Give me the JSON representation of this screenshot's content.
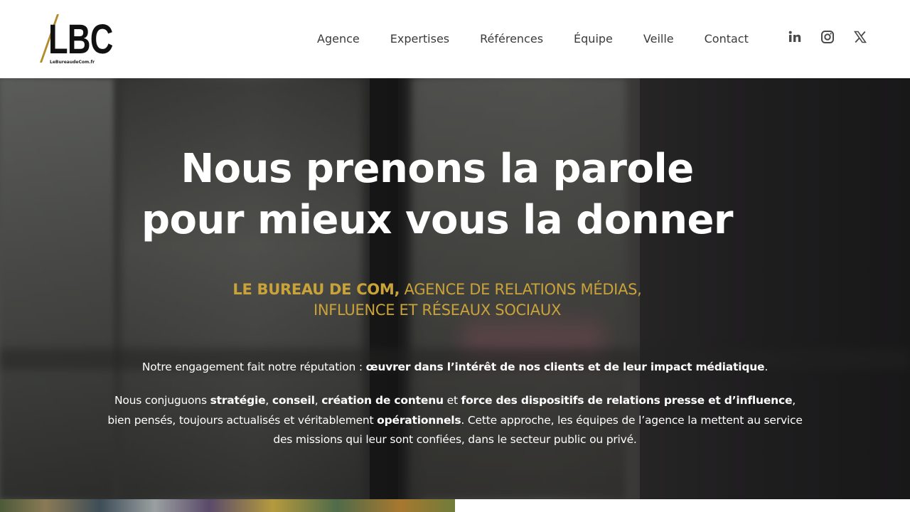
{
  "brand": {
    "logo_text": "LBC",
    "logo_subtext": "LeBureaudeCom.fr",
    "accent_color": "#c9a23a",
    "stroke_color": "#b38a2c"
  },
  "nav": {
    "items": [
      {
        "label": "Agence"
      },
      {
        "label": "Expertises"
      },
      {
        "label": "Références"
      },
      {
        "label": "Équipe"
      },
      {
        "label": "Veille"
      },
      {
        "label": "Contact"
      }
    ]
  },
  "social": {
    "linkedin_icon": "linkedin-icon",
    "instagram_icon": "instagram-icon",
    "x_icon": "x-icon"
  },
  "hero": {
    "title_line1": "Nous prenons la parole",
    "title_line2": "pour mieux vous la donner",
    "subtitle_bold": "LE BUREAU DE COM,",
    "subtitle_rest1": " AGENCE DE RELATIONS MÉDIAS,",
    "subtitle_line2": "INFLUENCE ET RÉSEAUX SOCIAUX",
    "p1_a": "Notre engagement fait notre réputation : ",
    "p1_b": "œuvrer dans l’intérêt de nos clients et de leur impact médiatique",
    "p1_c": ".",
    "p2_a": "Nous conjuguons ",
    "p2_b": "stratégie",
    "p2_c": ", ",
    "p2_d": "conseil",
    "p2_e": ", ",
    "p2_f": "création de contenu",
    "p2_g": " et ",
    "p2_h": "force des dispositifs de relations presse et d’influence",
    "p2_i": ", bien pensés, toujours actualisés et véritablement ",
    "p2_j": "opérationnels",
    "p2_k": ". Cette approche, les équipes de l’agence la mettent au service des missions qui leur sont confiées, dans le secteur public ou privé."
  }
}
